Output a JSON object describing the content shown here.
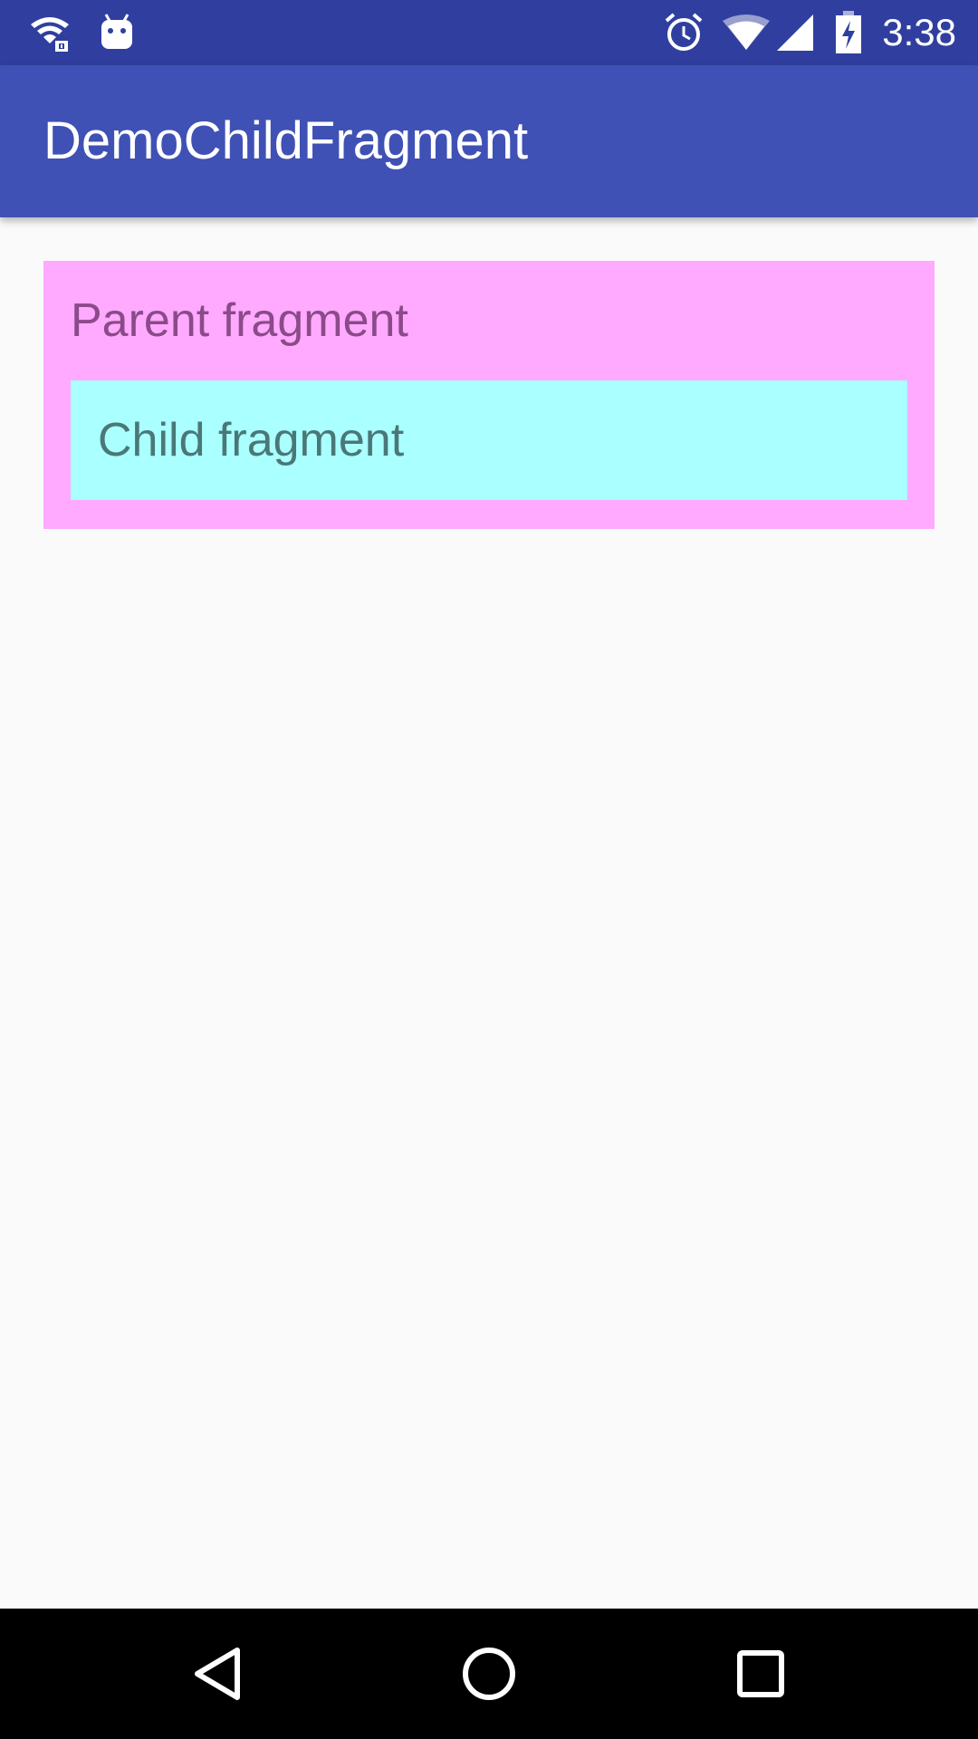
{
  "status_bar": {
    "time": "3:38",
    "icons": [
      "wifi-lock-icon",
      "android-debug-icon",
      "alarm-icon",
      "wifi-signal-icon",
      "cell-signal-icon",
      "battery-charging-icon"
    ]
  },
  "app_bar": {
    "title": "DemoChildFragment"
  },
  "content": {
    "parent_fragment": {
      "label": "Parent fragment",
      "background_color": "#ffaaff"
    },
    "child_fragment": {
      "label": "Child fragment",
      "background_color": "#aaffff"
    }
  },
  "nav_bar": {
    "buttons": [
      "back-icon",
      "home-icon",
      "recents-icon"
    ]
  },
  "colors": {
    "primary": "#3f51b5",
    "primary_dark": "#303f9f",
    "background": "#fafafa"
  }
}
